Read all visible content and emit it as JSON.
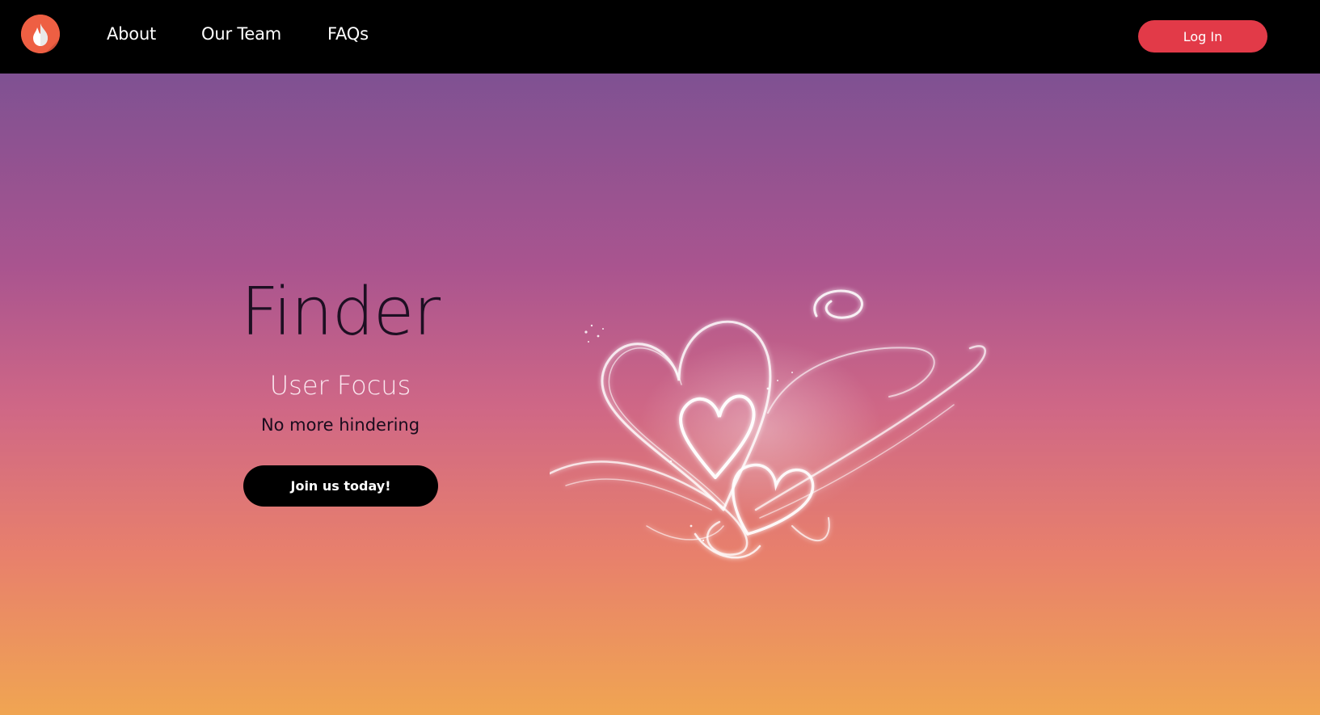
{
  "nav": {
    "logo_icon": "flame-icon",
    "links": [
      {
        "label": "About"
      },
      {
        "label": "Our Team"
      },
      {
        "label": "FAQs"
      }
    ],
    "login_label": "Log In"
  },
  "hero": {
    "title": "Finder",
    "subtitle": "User Focus",
    "tagline": "No more hindering",
    "cta_label": "Join us today!",
    "illustration": "glowing-hearts-illustration"
  },
  "colors": {
    "navbar": "#000000",
    "login_button": "#e23a48",
    "cta_button": "#000000",
    "gradient_top": "#7f5192",
    "gradient_bottom": "#f0a552"
  }
}
